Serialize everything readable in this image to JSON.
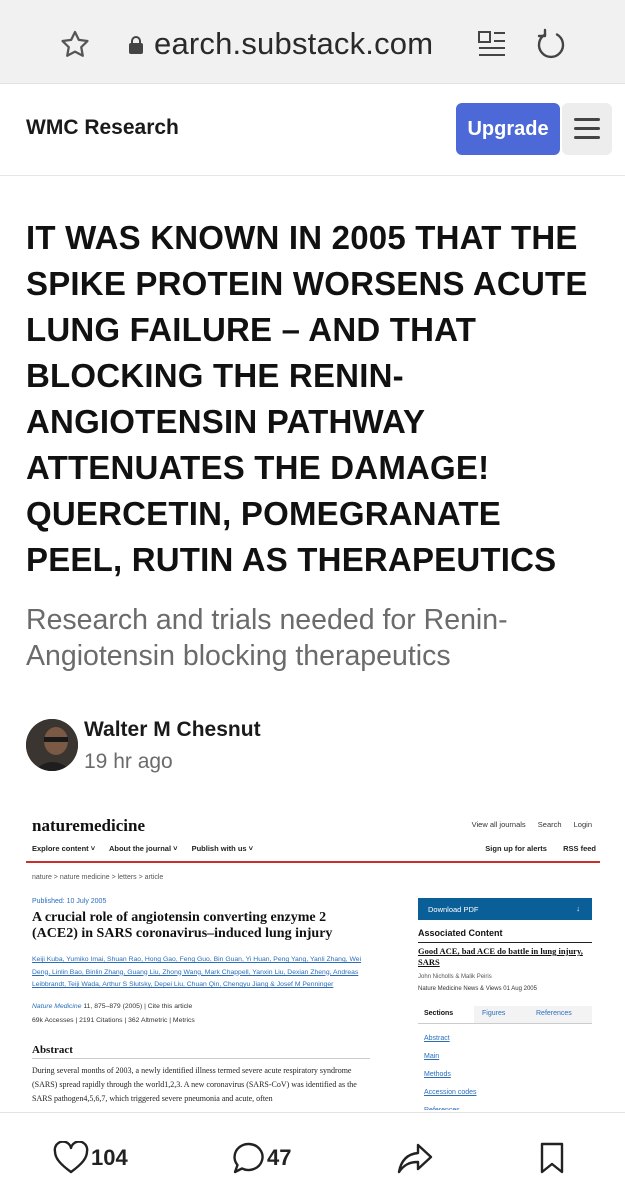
{
  "browser": {
    "url": "earch.substack.com"
  },
  "header": {
    "publication": "WMC Research",
    "upgrade_label": "Upgrade"
  },
  "article": {
    "title": "IT WAS KNOWN IN 2005 THAT THE SPIKE PROTEIN WORSENS ACUTE LUNG FAILURE – AND THAT BLOCKING THE RENIN-ANGIOTENSIN PATHWAY ATTENUATES THE DAMAGE! QUERCETIN, POMEGRANATE PEEL, RUTIN AS THERAPEUTICS",
    "subtitle": "Research and trials needed for Renin-Angiotensin blocking therapeutics",
    "author": "Walter M Chesnut",
    "date": "19 hr ago"
  },
  "embed": {
    "logo": "naturemedicine",
    "top_links": [
      "View all journals",
      "Search",
      "Login"
    ],
    "nav_left": [
      "Explore content ˅",
      "About the journal ˅",
      "Publish with us ˅"
    ],
    "nav_right": [
      "Sign up for alerts",
      "RSS feed"
    ],
    "breadcrumb": "nature  >  nature medicine  >  letters  >  article",
    "published": "Published: 10 July 2005",
    "title": "A crucial role of angiotensin converting enzyme 2 (ACE2) in SARS coronavirus–induced lung injury",
    "authors": "Keiji Kuba, Yumiko Imai, Shuan Rao, Hong Gao, Feng Guo, Bin Guan, Yi Huan, Peng Yang, Yanli Zhang, Wei Deng, Linlin Bao, Binlin Zhang, Guang Liu, Zhong Wang, Mark Chappell, Yanxin Liu, Dexian Zheng, Andreas Leibbrandt, Teiji Wada, Arthur S Slutsky, Depei Liu, Chuan Qin, Chengyu Jiang & Josef M Penninger",
    "journal_name": "Nature Medicine",
    "journal_ref": " 11, 875–879 (2005)  |  Cite this article",
    "metrics": "69k Accesses  |  2191 Citations  |  362 Altmetric  |  Metrics",
    "abstract_heading": "Abstract",
    "abstract_text": "During several months of 2003, a newly identified illness termed severe acute respiratory syndrome (SARS) spread rapidly through the world1,2,3. A new coronavirus (SARS-CoV) was identified as the SARS pathogen4,5,6,7, which triggered severe pneumonia and acute, often",
    "download_pdf": "Download PDF",
    "download_icon": "↓",
    "assoc_heading": "Associated Content",
    "assoc_title": "Good ACE, bad ACE do battle in lung injury, SARS",
    "assoc_by": "John Nicholls & Malik Peiris",
    "assoc_meta": "Nature Medicine   News & Views   01 Aug 2005",
    "tabs": [
      "Sections",
      "Figures",
      "References"
    ],
    "sections": [
      "Abstract",
      "Main",
      "Methods",
      "Accession codes",
      "References"
    ]
  },
  "actions": {
    "likes": "104",
    "comments": "47"
  }
}
